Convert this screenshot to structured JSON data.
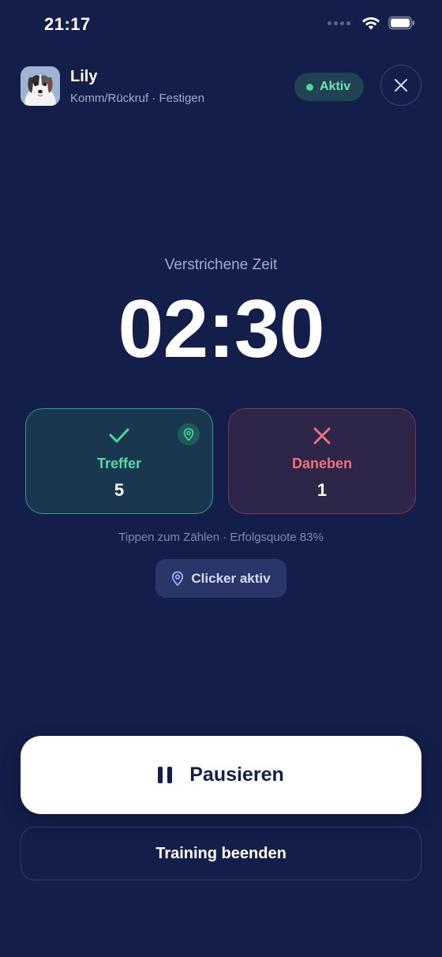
{
  "status_bar": {
    "time": "21:17"
  },
  "header": {
    "dog_name": "Lily",
    "subtitle": "Komm/Rückruf · Festigen",
    "status_label": "Aktiv"
  },
  "timer": {
    "label": "Verstrichene Zeit",
    "value": "02:30"
  },
  "counters": {
    "hit": {
      "label": "Treffer",
      "value": "5",
      "icon": "check-icon"
    },
    "miss": {
      "label": "Daneben",
      "value": "1",
      "icon": "x-icon"
    }
  },
  "hint": "Tippen zum Zählen · Erfolgsquote 83%",
  "clicker": {
    "label": "Clicker aktiv",
    "icon": "clicker-icon"
  },
  "actions": {
    "pause_label": "Pausieren",
    "end_label": "Training beenden"
  },
  "colors": {
    "background": "#141e4a",
    "success": "#58d8a9",
    "danger": "#f0717c",
    "active": "#6fe3b6"
  }
}
